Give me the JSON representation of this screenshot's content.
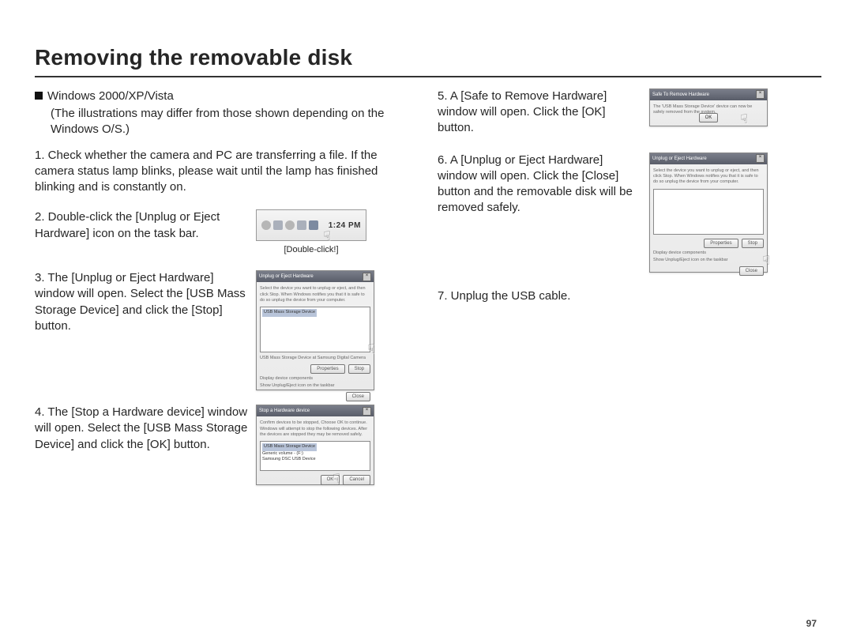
{
  "title": "Removing the removable disk",
  "page_number": "97",
  "os_heading": "Windows 2000/XP/Vista",
  "os_note": "(The illustrations may differ from those shown depending on the Windows O/S.)",
  "steps": {
    "s1": "1. Check whether the camera and PC are transferring a file. If the camera status lamp blinks, please wait until the lamp has finished blinking and is constantly on.",
    "s2": "2. Double-click the [Unplug or Eject Hardware] icon on the task bar.",
    "s2_caption": "[Double-click!]",
    "s2_clock": "1:24 PM",
    "s3": "3. The [Unplug or Eject Hardware] window will open. Select the [USB Mass Storage Device] and click the [Stop] button.",
    "s4": "4. The [Stop a Hardware device] window will open. Select the [USB Mass Storage Device] and click the [OK] button.",
    "s5": "5. A [Safe to Remove Hardware] window will open. Click the [OK] button.",
    "s6": "6. A [Unplug or Eject Hardware] window will open. Click the [Close] button and the removable disk will be removed safely.",
    "s7": "7. Unplug the USB cable."
  },
  "shots": {
    "unplug_window_title": "Unplug or Eject Hardware",
    "unplug_window_hint": "Select the device you want to unplug or eject, and then click Stop. When Windows notifies you that it is safe to do so unplug the device from your computer.",
    "unplug_listbox_item": "USB Mass Storage Device",
    "unplug_window_footer": "USB Mass Storage Device at Samsung Digital Camera",
    "unplug_check1": "Display device components",
    "unplug_check2": "Show Unplug/Eject icon on the taskbar",
    "btn_properties": "Properties",
    "btn_stop": "Stop",
    "btn_close": "Close",
    "stop_window_title": "Stop a Hardware device",
    "stop_window_hint": "Confirm devices to be stopped, Choose OK to continue. Windows will attempt to stop the following devices. After the devices are stopped they may be removed safely.",
    "stop_list_item1": "USB Mass Storage Device",
    "stop_list_item2": "Generic volume - (F:)",
    "stop_list_item3": "Samsung DSC USB Device",
    "btn_ok": "OK",
    "btn_cancel": "Cancel",
    "safe_window_title": "Safe To Remove Hardware",
    "safe_window_msg": "The 'USB Mass Storage Device' device can now be safely removed from the system."
  }
}
